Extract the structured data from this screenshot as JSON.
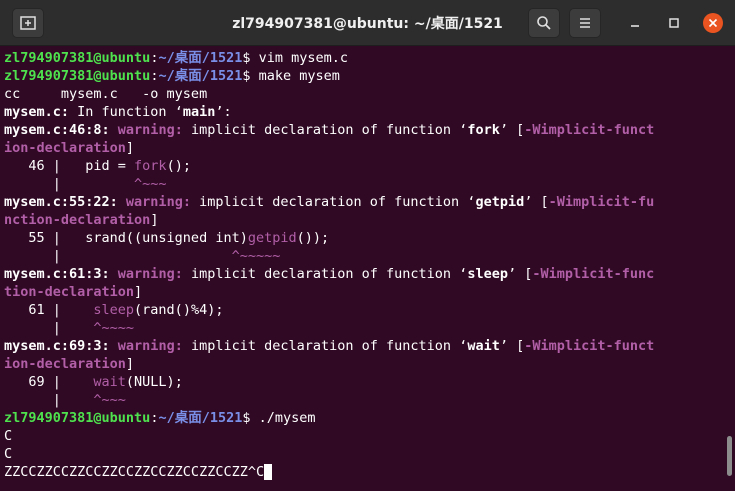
{
  "window": {
    "title": "zl794907381@ubuntu: ~/桌面/1521",
    "new_tab_icon": "new-tab-icon",
    "search_icon": "search-icon",
    "menu_icon": "hamburger-menu-icon",
    "close_color": "#e95420"
  },
  "prompt": {
    "user_host": "zl794907381@ubuntu",
    "sep": ":",
    "path": "~/桌面/1521",
    "dollar": "$"
  },
  "terminal": {
    "l1_cmd": " vim mysem.c",
    "l2_cmd": " make mysem",
    "l3": "cc     mysem.c   -o mysem",
    "l4a": "mysem.c:",
    "l4b": " In function ‘",
    "l4c": "main",
    "l4d": "’:",
    "l5a": "mysem.c:46:8:",
    "l5b": " warning:",
    "l5c": " implicit declaration of function ‘",
    "l5d": "fork",
    "l5e": "’ [",
    "l5f": "-Wimplicit-funct",
    "l6a": "ion-declaration",
    "l6b": "]",
    "l7a": "   46 |   pid = ",
    "l7b": "fork",
    "l7c": "();",
    "l8a": "      |         ",
    "l8b": "^~~~",
    "l9a": "mysem.c:55:22:",
    "l9b": " warning:",
    "l9c": " implicit declaration of function ‘",
    "l9d": "getpid",
    "l9e": "’ [",
    "l9f": "-Wimplicit-fu",
    "l10a": "nction-declaration",
    "l10b": "]",
    "l11a": "   55 |   srand((unsigned int)",
    "l11b": "getpid",
    "l11c": "());",
    "l12a": "      |                     ",
    "l12b": "^~~~~~",
    "l13a": "mysem.c:61:3:",
    "l13b": " warning:",
    "l13c": " implicit declaration of function ‘",
    "l13d": "sleep",
    "l13e": "’ [",
    "l13f": "-Wimplicit-func",
    "l14a": "tion-declaration",
    "l14b": "]",
    "l15a": "   61 |    ",
    "l15b": "sleep",
    "l15c": "(rand()%4);",
    "l16a": "      |    ",
    "l16b": "^~~~~",
    "l17a": "mysem.c:69:3:",
    "l17b": " warning:",
    "l17c": " implicit declaration of function ‘",
    "l17d": "wait",
    "l17e": "’ [",
    "l17f": "-Wimplicit-funct",
    "l18a": "ion-declaration",
    "l18b": "]",
    "l19a": "   69 |    ",
    "l19b": "wait",
    "l19c": "(NULL);",
    "l20a": "      |    ",
    "l20b": "^~~~",
    "l21_cmd": " ./mysem",
    "l22": "C",
    "l23": "C",
    "l24": "ZZCCZZCCZZCCZZCCZZCCZZCCZZCCZZ^C"
  }
}
